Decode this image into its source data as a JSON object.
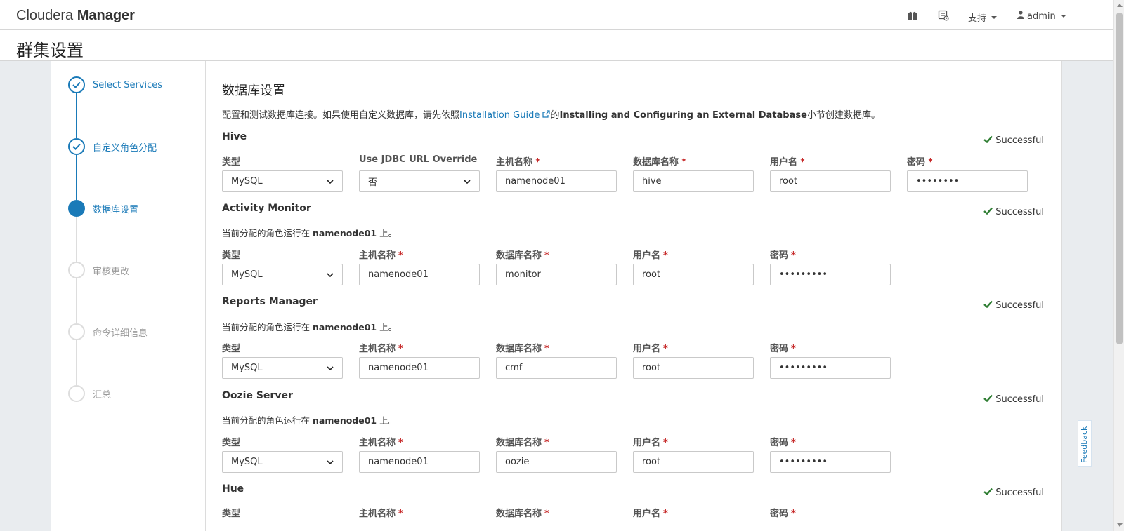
{
  "app": {
    "brand_light": "Cloudera ",
    "brand_bold": "Manager"
  },
  "topnav": {
    "support_label": "支持",
    "user_label": "admin"
  },
  "page": {
    "title": "群集设置"
  },
  "wizard": {
    "steps": [
      {
        "label": "Select Services",
        "state": "done"
      },
      {
        "label": "自定义角色分配",
        "state": "done"
      },
      {
        "label": "数据库设置",
        "state": "current"
      },
      {
        "label": "审核更改",
        "state": "todo"
      },
      {
        "label": "命令详细信息",
        "state": "todo"
      },
      {
        "label": "汇总",
        "state": "todo"
      }
    ]
  },
  "section": {
    "title": "数据库设置",
    "desc_prefix": "配置和测试数据库连接。如果使用自定义数据库，请先依照",
    "desc_link": "Installation Guide",
    "desc_mid": "的",
    "desc_bold": "Installing and Configuring an External Database",
    "desc_suffix": "小节创建数据库。"
  },
  "labels": {
    "type": "类型",
    "jdbc_override": "Use JDBC URL Override",
    "host": "主机名称",
    "dbname": "数据库名称",
    "user": "用户名",
    "password": "密码",
    "required_mark": "*",
    "success": "Successful",
    "note_prefix": "当前分配的角色运行在 ",
    "note_suffix": " 上。"
  },
  "services": {
    "hive": {
      "name": "Hive",
      "type": "MySQL",
      "jdbc_override": "否",
      "host": "namenode01",
      "dbname": "hive",
      "user": "root",
      "password": "••••••••"
    },
    "activity_monitor": {
      "name": "Activity Monitor",
      "assigned_host": "namenode01",
      "type": "MySQL",
      "host": "namenode01",
      "dbname": "monitor",
      "user": "root",
      "password": "•••••••••"
    },
    "reports_manager": {
      "name": "Reports Manager",
      "assigned_host": "namenode01",
      "type": "MySQL",
      "host": "namenode01",
      "dbname": "cmf",
      "user": "root",
      "password": "•••••••••"
    },
    "oozie": {
      "name": "Oozie Server",
      "assigned_host": "namenode01",
      "type": "MySQL",
      "host": "namenode01",
      "dbname": "oozie",
      "user": "root",
      "password": "•••••••••"
    },
    "hue": {
      "name": "Hue"
    }
  },
  "feedback": {
    "label": "Feedback"
  },
  "colors": {
    "accent": "#1a7ab8",
    "success_check": "#2e7d32",
    "required": "#c62828"
  }
}
